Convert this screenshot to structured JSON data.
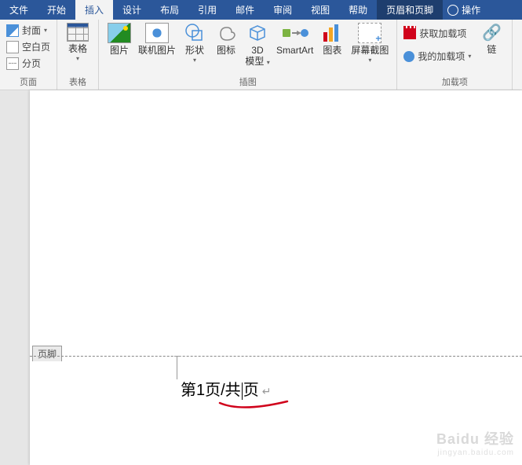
{
  "tabs": {
    "file": "文件",
    "home": "开始",
    "insert": "插入",
    "design": "设计",
    "layout": "布局",
    "references": "引用",
    "mailings": "邮件",
    "review": "审阅",
    "view": "视图",
    "help": "帮助",
    "header_footer": "页眉和页脚",
    "tell_me": "操作"
  },
  "ribbon": {
    "pages": {
      "cover": "封面",
      "blank": "空白页",
      "break": "分页",
      "group": "页面"
    },
    "tables": {
      "table": "表格",
      "group": "表格"
    },
    "illustrations": {
      "picture": "图片",
      "online_picture": "联机图片",
      "shapes": "形状",
      "icons": "图标",
      "model3d_l1": "3D",
      "model3d_l2": "模型",
      "smartart": "SmartArt",
      "chart": "图表",
      "screenshot": "屏幕截图",
      "group": "插图"
    },
    "addins": {
      "get": "获取加载项",
      "my": "我的加载项",
      "link": "链",
      "group": "加载项"
    }
  },
  "document": {
    "footer_label": "页脚",
    "footer_text_before": "第1页/共",
    "footer_text_after": "页"
  },
  "watermark": {
    "main": "Baidu 经验",
    "sub": "jingyan.baidu.com"
  }
}
